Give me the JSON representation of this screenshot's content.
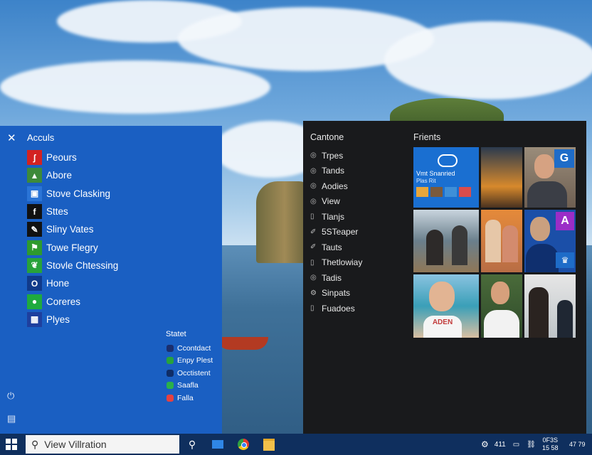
{
  "left_panel": {
    "title": "Acculs",
    "apps": [
      {
        "label": "Peours",
        "icon": "acrobat-icon",
        "color": "#d32222"
      },
      {
        "label": "Abore",
        "icon": "photo-app-icon",
        "color": "#3d8a3a"
      },
      {
        "label": "Stove Clasking",
        "icon": "stove-icon",
        "color": "#2a74d6"
      },
      {
        "label": "Sttes",
        "icon": "f-icon",
        "color": "#111111"
      },
      {
        "label": "Sliny Vates",
        "icon": "pen-icon",
        "color": "#111111"
      },
      {
        "label": "Towe Flegry",
        "icon": "flag-icon",
        "color": "#2e9a2e"
      },
      {
        "label": "Stovle Chtessing",
        "icon": "leaf-icon",
        "color": "#28a23a"
      },
      {
        "label": "Hone",
        "icon": "home-icon",
        "color": "#103a8a"
      },
      {
        "label": "Coreres",
        "icon": "chat-icon",
        "color": "#1faa3e"
      },
      {
        "label": "Plyes",
        "icon": "puzzle-icon",
        "color": "#1e3f9e"
      }
    ],
    "section_label": "Statet",
    "sub_items": [
      {
        "label": "Ccontdact",
        "color": "#1b2e6d"
      },
      {
        "label": "Enpy Plest",
        "color": "#27a33c"
      },
      {
        "label": "Occtistent",
        "color": "#0f2d66"
      },
      {
        "label": "Saafla",
        "color": "#2ab04a"
      },
      {
        "label": "Falla",
        "color": "#e54141"
      }
    ]
  },
  "right_panel": {
    "header": "Cantone",
    "items": [
      {
        "label": "Trpes",
        "icon": "circle-icon"
      },
      {
        "label": "Tands",
        "icon": "circle-icon"
      },
      {
        "label": "Aodies",
        "icon": "circle-icon"
      },
      {
        "label": "View",
        "icon": "circle-icon"
      },
      {
        "label": "Tlanjs",
        "icon": "doc-icon"
      },
      {
        "label": "5STeaper",
        "icon": "pen-icon"
      },
      {
        "label": "Tauts",
        "icon": "pen-icon"
      },
      {
        "label": "Thetlowiay",
        "icon": "doc-icon"
      },
      {
        "label": "Tadis",
        "icon": "circle-icon"
      },
      {
        "label": "Sinpats",
        "icon": "gear-icon"
      },
      {
        "label": "Fuadoes",
        "icon": "doc-icon"
      }
    ],
    "friends_title": "Frients",
    "onedrive_tile_text": "Vmt Snanried",
    "onedrive_tile_sub": "Plas Rit",
    "badge_g": "G",
    "badge_a": "A",
    "shirt_text": "ADEN"
  },
  "taskbar": {
    "search_text": "View Villration",
    "tray_number": "411",
    "clock_top": "0F3S",
    "clock_bottom": "15 58",
    "clock_right": "47 79",
    "colors": {
      "taskbar": "#0f2f5e",
      "start_blue": "#1a5fc2",
      "dark": "#191a1c"
    }
  }
}
